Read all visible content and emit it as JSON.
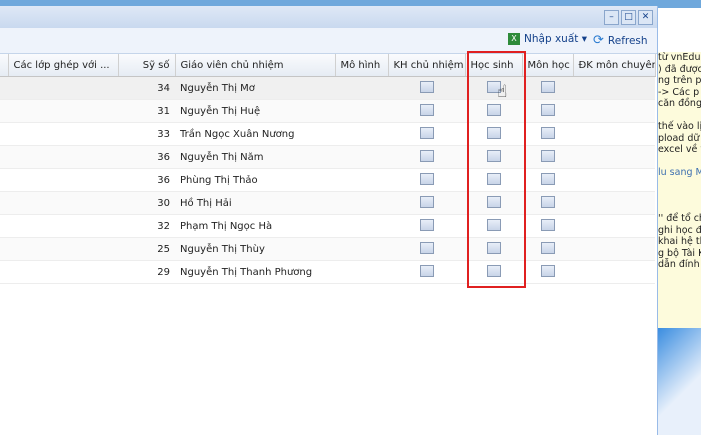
{
  "window": {
    "minimize": "–",
    "maximize": "□",
    "close": "✕"
  },
  "toolbar": {
    "import_export": "Nhập xuất ▾",
    "refresh": "Refresh"
  },
  "columns": [
    "",
    "Các lớp ghép với ...",
    "Sỹ số",
    "Giáo viên chủ nhiệm",
    "Mô hình",
    "KH chủ nhiệm",
    "Học sinh",
    "Môn học",
    "ĐK môn chuyên"
  ],
  "rows": [
    {
      "size": "34",
      "teacher": "Nguyễn Thị Mơ"
    },
    {
      "size": "31",
      "teacher": "Nguyễn Thị Huệ"
    },
    {
      "size": "33",
      "teacher": "Trần Ngọc Xuân Nương"
    },
    {
      "size": "36",
      "teacher": "Nguyễn Thị Năm"
    },
    {
      "size": "36",
      "teacher": "Phùng Thị Thảo"
    },
    {
      "size": "30",
      "teacher": "Hồ Thị Hải"
    },
    {
      "size": "32",
      "teacher": "Phạm Thị Ngọc Hà"
    },
    {
      "size": "25",
      "teacher": "Nguyễn Thị Thùy"
    },
    {
      "size": "29",
      "teacher": "Nguyễn Thị Thanh Phương"
    }
  ],
  "side_panel": [
    "từ vnEdu",
    ") đã được",
    "ng trên p",
    "-> Các p",
    "căn đồng",
    "",
    "thế vào lị",
    "pload dữ",
    "excel về v",
    "",
    "lu sang M",
    "",
    "",
    "",
    "'' để tổ ch",
    "ghi học đề",
    "khai hệ th",
    "g bộ Tài K",
    "dẫn đính"
  ]
}
